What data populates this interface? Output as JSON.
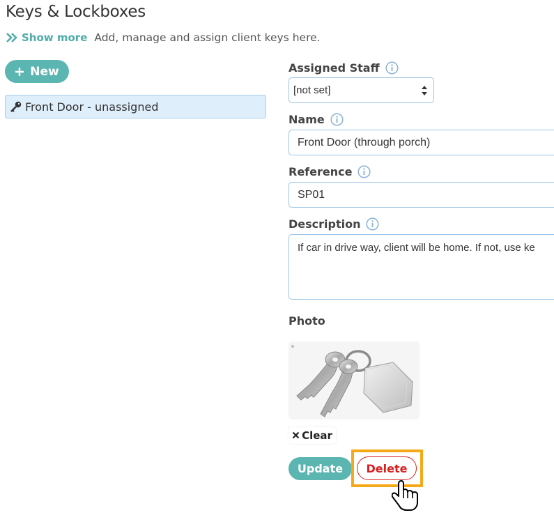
{
  "page": {
    "title": "Keys & Lockboxes",
    "show_more_label": "Show more",
    "subtitle": "Add, manage and assign client keys here."
  },
  "toolbar": {
    "new_label": "New"
  },
  "key_list": {
    "items": [
      {
        "label": "Front Door - unassigned",
        "icon": "key-icon",
        "selected": true
      }
    ]
  },
  "form": {
    "assigned_staff": {
      "label": "Assigned Staff",
      "value": "[not set]"
    },
    "name": {
      "label": "Name",
      "value": "Front Door (through porch)"
    },
    "reference": {
      "label": "Reference",
      "value": "SP01"
    },
    "description": {
      "label": "Description",
      "value": "If car in drive way, client will be home. If not, use ke"
    },
    "photo": {
      "label": "Photo",
      "clear_label": "Clear"
    }
  },
  "actions": {
    "update_label": "Update",
    "delete_label": "Delete"
  },
  "colors": {
    "accent": "#5bb5b1",
    "danger": "#d62020",
    "highlight": "#f6a917",
    "selected_bg": "#dfeefb",
    "input_border": "#9cc4e6"
  }
}
